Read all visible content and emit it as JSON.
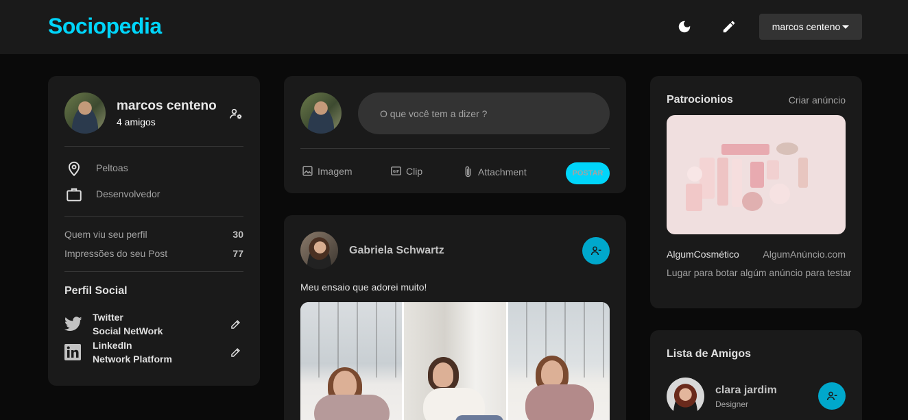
{
  "navbar": {
    "brand": "Sociopedia",
    "user_select": "marcos centeno",
    "icons": [
      "moon-icon",
      "edit-icon"
    ]
  },
  "profile": {
    "name": "marcos centeno",
    "friends": "4 amigos",
    "location": "Peltoas",
    "occupation": "Desenvolvedor",
    "stats": [
      {
        "label": "Quem viu seu perfil",
        "value": "30"
      },
      {
        "label": "Impressões do seu Post",
        "value": "77"
      }
    ],
    "social_title": "Perfil Social",
    "social": [
      {
        "name": "Twitter",
        "subtitle": "Social NetWork",
        "icon": "twitter-icon"
      },
      {
        "name": "LinkedIn",
        "subtitle": "Network Platform",
        "icon": "linkedin-icon"
      }
    ]
  },
  "creator": {
    "placeholder": "O que você tem a dizer ?",
    "actions": [
      {
        "label": "Imagem",
        "icon": "image-icon"
      },
      {
        "label": "Clip",
        "icon": "gif-icon"
      },
      {
        "label": "Attachment",
        "icon": "paperclip-icon"
      }
    ],
    "post_button": "POSTAR"
  },
  "post": {
    "author": "Gabriela Schwartz",
    "description": "Meu ensaio que adorei muito!"
  },
  "ads": {
    "title": "Patrocionios",
    "create": "Criar anúncio",
    "brand": "AlgumCosmético",
    "url": "AlgumAnúncio.com",
    "text": "Lugar para botar algúm anúncio para testar"
  },
  "friends": {
    "title": "Lista de Amigos",
    "items": [
      {
        "name": "clara jardim",
        "role": "Designer"
      }
    ]
  },
  "colors": {
    "accent": "#00d5fa",
    "background": "#0a0a0a",
    "card": "#1a1a1a",
    "input": "#333333"
  }
}
